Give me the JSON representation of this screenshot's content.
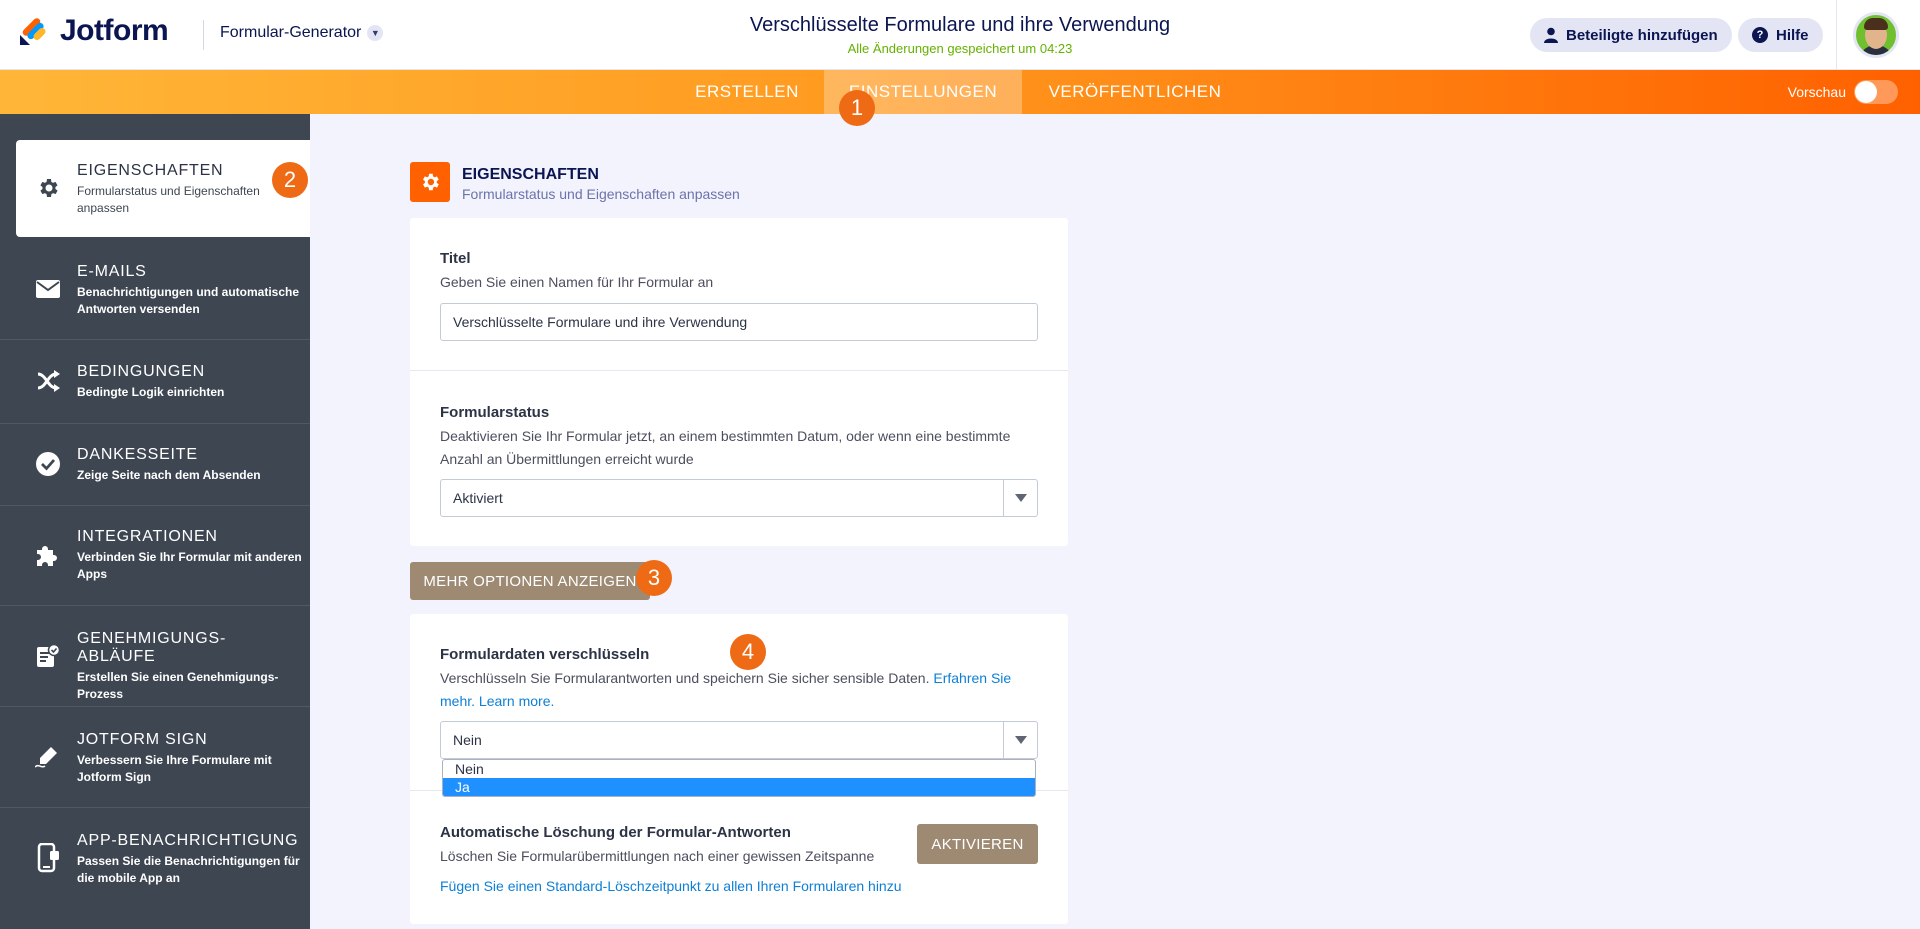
{
  "header": {
    "logo_text": "Jotform",
    "builder_label": "Formular-Generator",
    "form_title": "Verschlüsselte Formulare und ihre Verwendung",
    "saved_status": "Alle Änderungen gespeichert um 04:23",
    "add_participants": "Beteiligte hinzufügen",
    "help": "Hilfe"
  },
  "nav": {
    "tabs": [
      {
        "label": "ERSTELLEN"
      },
      {
        "label": "EINSTELLUNGEN"
      },
      {
        "label": "VERÖFFENTLICHEN"
      }
    ],
    "preview_label": "Vorschau",
    "preview_enabled": false
  },
  "badges": [
    "1",
    "2",
    "3",
    "4"
  ],
  "sidebar": {
    "items": [
      {
        "title": "EIGENSCHAFTEN",
        "subtitle": "Formularstatus und Eigenschaften anpassen",
        "icon": "gear-icon",
        "active": true
      },
      {
        "title": "E-MAILS",
        "subtitle": "Benachrichtigungen und automatische Antworten versenden",
        "icon": "envelope-icon"
      },
      {
        "title": "BEDINGUNGEN",
        "subtitle": "Bedingte Logik einrichten",
        "icon": "shuffle-icon"
      },
      {
        "title": "DANKESSEITE",
        "subtitle": "Zeige Seite nach dem Absenden",
        "icon": "check-circle-icon"
      },
      {
        "title": "INTEGRATIONEN",
        "subtitle": "Verbinden Sie Ihr Formular mit anderen Apps",
        "icon": "puzzle-icon"
      },
      {
        "title": "GENEHMIGUNGS-ABLÄUFE",
        "subtitle": "Erstellen Sie einen Genehmigungs-Prozess",
        "icon": "approval-icon"
      },
      {
        "title": "JOTFORM SIGN",
        "subtitle": "Verbessern Sie Ihre Formulare mit Jotform Sign",
        "icon": "pen-icon"
      },
      {
        "title": "APP-BENACHRICHTIGUNG",
        "subtitle": "Passen Sie die Benachrichtigungen für die mobile App an",
        "icon": "phone-icon"
      }
    ]
  },
  "section": {
    "title": "EIGENSCHAFTEN",
    "subtitle": "Formularstatus und Eigenschaften anpassen"
  },
  "title_field": {
    "label": "Titel",
    "description": "Geben Sie einen Namen für Ihr Formular an",
    "value": "Verschlüsselte Formulare und ihre Verwendung"
  },
  "status_field": {
    "label": "Formularstatus",
    "description": "Deaktivieren Sie Ihr Formular jetzt, an einem bestimmten Datum, oder wenn eine bestimmte Anzahl an Übermittlungen erreicht wurde",
    "value": "Aktiviert"
  },
  "more_options": "MEHR OPTIONEN ANZEIGEN",
  "encrypt_field": {
    "label": "Formulardaten verschlüsseln",
    "description": "Verschlüsseln Sie Formularantworten und speichern Sie sicher sensible Daten.",
    "link1": "Erfahren Sie mehr.",
    "link2": "Learn more.",
    "value": "Nein",
    "options": [
      "Nein",
      "Ja"
    ],
    "highlighted_option": "Ja"
  },
  "auto_delete": {
    "label": "Automatische Löschung der Formular-Antworten",
    "description": "Löschen Sie Formularübermittlungen nach einer gewissen Zeitspanne",
    "button": "AKTIVIEREN",
    "link": "Fügen Sie einen Standard-Löschzeitpunkt zu allen Ihren Formularen hinzu"
  },
  "colors": {
    "accent_orange": "#ff6100",
    "nav_dark": "#0a1551",
    "sidebar_bg": "#3e4652",
    "button_brown": "#9e8a73",
    "link_blue": "#0d7fd5",
    "saved_green": "#64b200"
  }
}
